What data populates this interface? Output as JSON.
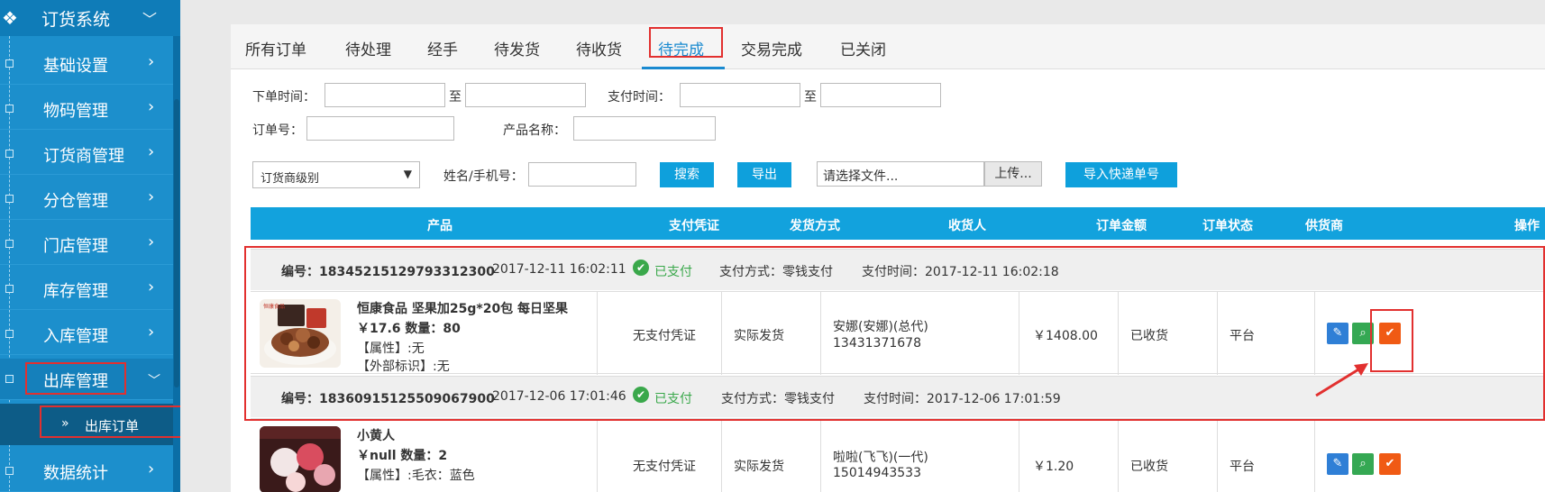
{
  "sidebar": {
    "system_title": "订货系统",
    "items": [
      {
        "label": "基础设置"
      },
      {
        "label": "物码管理"
      },
      {
        "label": "订货商管理"
      },
      {
        "label": "分仓管理"
      },
      {
        "label": "门店管理"
      },
      {
        "label": "库存管理"
      },
      {
        "label": "入库管理"
      },
      {
        "label": "出库管理"
      },
      {
        "label": "数据统计"
      }
    ],
    "sub_item": {
      "label": "出库订单"
    }
  },
  "tabs": [
    {
      "label": "所有订单"
    },
    {
      "label": "待处理"
    },
    {
      "label": "经手"
    },
    {
      "label": "待发货"
    },
    {
      "label": "待收货"
    },
    {
      "label": "待完成"
    },
    {
      "label": "交易完成"
    },
    {
      "label": "已关闭"
    }
  ],
  "filters": {
    "order_time_label": "下单时间：",
    "to1": "至",
    "pay_time_label": "支付时间：",
    "to2": "至",
    "order_no_label": "订单号：",
    "product_name_label": "产品名称：",
    "dealer_level_select": "订货商级别",
    "name_phone_label": "姓名/手机号：",
    "search_button": "搜索",
    "export_button": "导出",
    "file_placeholder": "请选择文件...",
    "upload_button": "上传...",
    "import_button": "导入快递单号"
  },
  "table": {
    "headers": {
      "product": "产品",
      "pay_proof": "支付凭证",
      "ship_method": "发货方式",
      "receiver": "收货人",
      "amount": "订单金额",
      "status": "订单状态",
      "supplier": "供货商",
      "ops": "操作"
    }
  },
  "orders": [
    {
      "no": "编号：18345215129793312300",
      "order_time": "2017-12-11 16:02:11",
      "paid": "已支付",
      "pay_method": "支付方式：零钱支付",
      "pay_time": "支付时间：2017-12-11 16:02:18",
      "product_name": "恒康食品 坚果加25g*20包 每日坚果",
      "price_qty": "￥17.6 数量：80",
      "attr": "【属性】:无",
      "external_mark": "【外部标识】:无",
      "pay_proof": "无支付凭证",
      "ship": "实际发货",
      "receiver_name": "安娜(安娜)(总代)",
      "receiver_phone": "13431371678",
      "amount": "￥1408.00",
      "status": "已收货",
      "supplier": "平台"
    },
    {
      "no": "编号：18360915125509067900",
      "order_time": "2017-12-06 17:01:46",
      "paid": "已支付",
      "pay_method": "支付方式：零钱支付",
      "pay_time": "支付时间：2017-12-06 17:01:59",
      "product_name": "小黄人",
      "price_qty": "￥null 数量：2",
      "attr": "【属性】:毛衣：蓝色",
      "pay_proof": "无支付凭证",
      "ship": "实际发货",
      "receiver_name": "啦啦(飞飞)(一代)",
      "receiver_phone": "15014943533",
      "amount": "￥1.20",
      "status": "已收货",
      "supplier": "平台"
    }
  ],
  "colors": {
    "sidebar_bg": "#1c8fcc",
    "accent": "#12a2dd",
    "annotation": "#e2302f",
    "paid_green": "#3aa84b"
  }
}
